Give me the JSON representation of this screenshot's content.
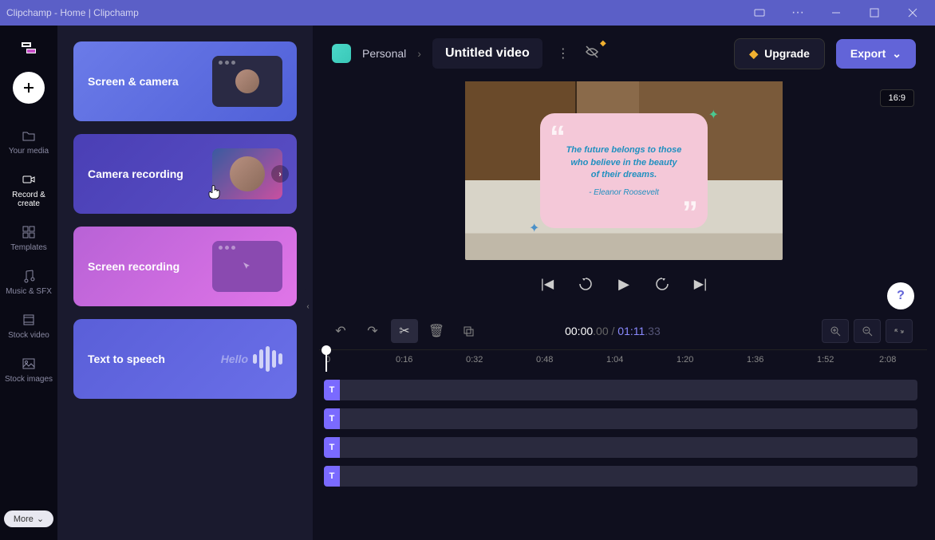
{
  "window": {
    "title": "Clipchamp - Home | Clipchamp"
  },
  "sidebar": {
    "add_tooltip": "Add",
    "items": [
      {
        "label": "Your media",
        "icon": "folder-icon"
      },
      {
        "label": "Record & create",
        "icon": "camera-icon"
      },
      {
        "label": "Templates",
        "icon": "templates-icon"
      },
      {
        "label": "Music & SFX",
        "icon": "music-icon"
      },
      {
        "label": "Stock video",
        "icon": "film-icon"
      },
      {
        "label": "Stock images",
        "icon": "image-icon"
      }
    ],
    "more_label": "More"
  },
  "panel": {
    "cards": [
      {
        "title": "Screen & camera"
      },
      {
        "title": "Camera recording"
      },
      {
        "title": "Screen recording"
      },
      {
        "title": "Text to speech",
        "hello": "Hello"
      }
    ]
  },
  "header": {
    "workspace": "Personal",
    "project_title": "Untitled video",
    "upgrade_label": "Upgrade",
    "export_label": "Export"
  },
  "preview": {
    "aspect": "16:9",
    "quote_line1": "The future belongs to those",
    "quote_line2": "who believe in the beauty",
    "quote_line3": "of their dreams.",
    "quote_author": "- Eleanor Roosevelt"
  },
  "timeline": {
    "current": "00:00",
    "current_frac": ".00",
    "separator": " / ",
    "duration": "01:11",
    "duration_frac": ".33",
    "ticks": [
      "0",
      "0:16",
      "0:32",
      "0:48",
      "1:04",
      "1:20",
      "1:36",
      "1:52",
      "2:08"
    ],
    "tracks": [
      {
        "type": "T"
      },
      {
        "type": "T"
      },
      {
        "type": "T"
      },
      {
        "type": "T"
      }
    ]
  },
  "help_label": "?"
}
